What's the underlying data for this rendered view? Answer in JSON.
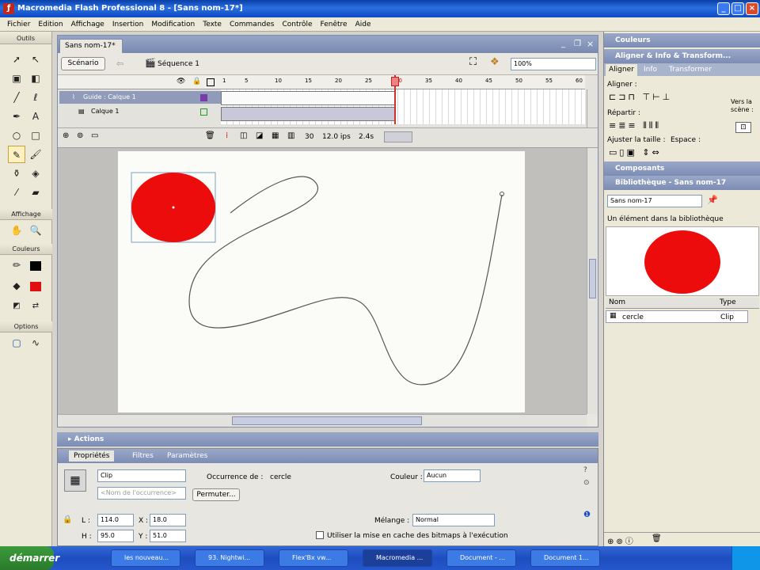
{
  "window": {
    "title": "Macromedia Flash Professional 8 - [Sans nom-17*]"
  },
  "menu": [
    "Fichier",
    "Edition",
    "Affichage",
    "Insertion",
    "Modification",
    "Texte",
    "Commandes",
    "Contrôle",
    "Fenêtre",
    "Aide"
  ],
  "toolbox": {
    "tools_label": "Outils",
    "view_label": "Affichage",
    "colors_label": "Couleurs",
    "options_label": "Options"
  },
  "document": {
    "tab": "Sans nom-17*",
    "scene_btn": "Scénario",
    "sequence": "Séquence 1",
    "zoom": "100%",
    "layers": [
      {
        "name": "Guide : Calque 1"
      },
      {
        "name": "Calque 1"
      }
    ],
    "ruler": [
      "1",
      "5",
      "10",
      "15",
      "20",
      "25",
      "30",
      "35",
      "40",
      "45",
      "50",
      "55",
      "60"
    ],
    "status": {
      "frame": "30",
      "fps": "12.0 ips",
      "time": "2.4s"
    }
  },
  "actions_panel": {
    "title": "Actions"
  },
  "properties": {
    "tabs": [
      "Propriétés",
      "Filtres",
      "Paramètres"
    ],
    "type_select": "Clip",
    "instance_placeholder": "<Nom de l'occurrence>",
    "instance_of_label": "Occurrence de :",
    "instance_of": "cercle",
    "swap_btn": "Permuter...",
    "color_label": "Couleur :",
    "color_value": "Aucun",
    "blend_label": "Mélange :",
    "blend_value": "Normal",
    "cache_label": "Utiliser la mise en cache des bitmaps à l'exécution",
    "L_label": "L :",
    "L": "114.0",
    "X_label": "X :",
    "X": "18.0",
    "H_label": "H :",
    "H": "95.0",
    "Y_label": "Y :",
    "Y": "51.0"
  },
  "right_panels": {
    "colors": "Couleurs",
    "align": "Aligner & Info & Transform...",
    "align_tabs": [
      "Aligner",
      "Info",
      "Transformer"
    ],
    "align_label": "Aligner :",
    "distribute_label": "Répartir :",
    "match_size_label": "Ajuster la taille :",
    "space_label": "Espace :",
    "to_stage_label": "Vers la scène :",
    "components": "Composants",
    "library": "Bibliothèque - Sans nom-17",
    "library_select": "Sans nom-17",
    "library_count": "Un élément dans la bibliothèque",
    "col_name": "Nom",
    "col_type": "Type",
    "items": [
      {
        "name": "cercle",
        "type": "Clip"
      }
    ]
  },
  "taskbar": {
    "start": "démarrer",
    "tasks": [
      "les nouveau...",
      "93. Nightwi...",
      "Flex'Bx vw...",
      "Macromedia ...",
      "Document - ...",
      "Document 1..."
    ]
  },
  "colors": {
    "circle": "#ec0c0c",
    "titlebar": "#0a3fa8"
  }
}
